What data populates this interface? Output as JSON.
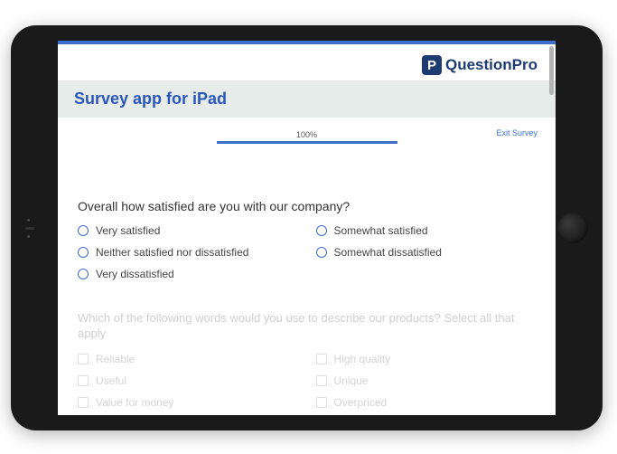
{
  "logo": {
    "badge": "P",
    "text": "QuestionPro"
  },
  "title": "Survey app for iPad",
  "progress": {
    "label": "100%",
    "percent": 100
  },
  "exit": "Exit Survey",
  "q1": {
    "question": "Overall how satisfied are you with our company?",
    "options": [
      "Very satisfied",
      "Somewhat satisfied",
      "Neither satisfied nor dissatisfied",
      "Somewhat dissatisfied",
      "Very dissatisfied"
    ]
  },
  "q2": {
    "question": "Which of the following words would you use to describe our products? Select all that apply",
    "options": [
      "Reliable",
      "High quality",
      "Useful",
      "Unique",
      "Value for money",
      "Overpriced"
    ]
  }
}
